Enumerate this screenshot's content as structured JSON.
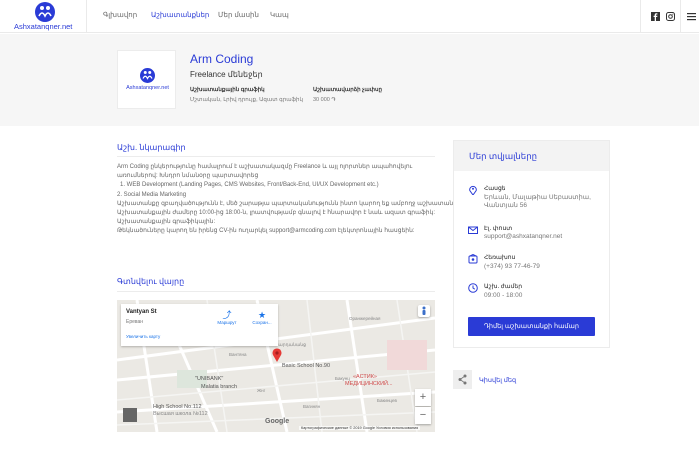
{
  "header": {
    "logo_text": "Ashxatanqner.net",
    "nav": [
      "Գլխավոր",
      "Աշխատանքներ",
      "Մեր մասին",
      "Կապ"
    ],
    "active_index": 1,
    "social_icons": [
      "facebook-icon",
      "instagram-icon"
    ],
    "menu_icon": "hamburger-menu-icon"
  },
  "job": {
    "company_logo_text": "Ashxatanqner.net",
    "title": "Arm Coding",
    "subtitle": "Freelance մենեջեր",
    "meta": [
      {
        "label": "Աշխատանքային գրաֆիկ",
        "value": "Մշտական, Լրիվ դրույք, Ազատ գրաֆիկ"
      },
      {
        "label": "Աշխատավարձի չափսը",
        "value": "30 000 ֏"
      }
    ]
  },
  "description": {
    "title": "Աշխ. նկարագիր",
    "lines": [
      "Arm Coding ընկերությունը համալրում է աշխատակազմը Freelance և այլ ոլորտներ ապահովելու",
      "առումներով: Խնդրո նմանօրը պարտավորեց",
      "1. WEB Development (Landing Pages, CMS Websites, Front/Back-End, UI/UX Development etc.)",
      "2. Social Media Marketing",
      "Աշխատանքը զբաղվածությունն է, մեծ շարաթյա պարտականությունն ինտո կարող եք ամբողջ աշխատանք:",
      "Աշխատանքային ժամերը 10:00-ից 18:00-ն, լրատվությամբ գնալով է հնարավոր է նաև ազատ գրաֆիկ:",
      "Աշխատանքային գրաֆիկային:",
      "Թեկնածուները կարող են իրենց CV-ին ուղարկել support@armcoding.com էլեկտրոնային հասցեին:"
    ]
  },
  "map_section": {
    "title": "Գտնվելու վայրը",
    "card": {
      "place_name": "Vantyan St",
      "city": "Ереван",
      "bigger_map": "Увеличить карту",
      "directions": "Маршрут",
      "save": "Сохран..."
    },
    "pois": [
      {
        "name": "Basic School No.90",
        "color": "#555555"
      },
      {
        "name": "«АСТИК»",
        "color": "#d04a4a"
      },
      {
        "name": "МЕДИЦИНСКИЙ...",
        "color": "#d04a4a"
      },
      {
        "name": "\"UNIBANK\"",
        "color": "#555555"
      },
      {
        "name": "Malatia branch",
        "color": "#555555"
      },
      {
        "name": "High School No.112",
        "color": "#555555"
      },
      {
        "name": "Высшая школа №112",
        "color": "#888888"
      }
    ],
    "streets": [
      "Վարդանանց",
      "Бакунц",
      "Оранжерейная",
      "Вантяна",
      "Вагинян",
      "Бакинцев",
      "Жнг"
    ],
    "google": "Google",
    "terms": "Картографические данные © 2019 Google   Условия использования",
    "zoom_in": "+",
    "zoom_out": "−"
  },
  "sidebar": {
    "title": "Մեր տվյալները",
    "items": [
      {
        "icon": "location-pin-icon",
        "label": "Հասցե",
        "value": [
          "Երևան, Մալաթիա Սեբաստիա,",
          "Վանտյան 56"
        ]
      },
      {
        "icon": "email-icon",
        "label": "Էլ. փոստ",
        "value": [
          "support@ashxatanqner.net"
        ]
      },
      {
        "icon": "phone-icon",
        "label": "Հեռախոս",
        "value": [
          "(+374) 93 77-46-79"
        ]
      },
      {
        "icon": "clock-icon",
        "label": "Աշխ. ժամեր",
        "value": [
          "09:00 - 18:00"
        ]
      }
    ],
    "apply_button": "Դիմել աշխատանքի համար",
    "share_label": "Կիսվել մեզ"
  },
  "colors": {
    "brand": "#2a3bd6",
    "hero_bg": "#f6f6f6",
    "map_bg": "#e9e7e2"
  }
}
